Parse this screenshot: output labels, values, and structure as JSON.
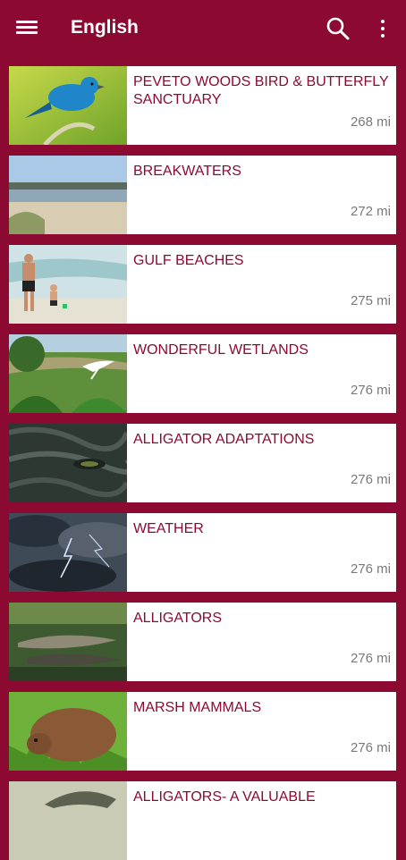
{
  "appbar": {
    "title": "English"
  },
  "items": [
    {
      "name": "PEVETO WOODS BIRD & BUTTERFLY SANCTUARY",
      "distance": "268 mi",
      "image": "indigo-bunting-bird"
    },
    {
      "name": "BREAKWATERS",
      "distance": "272 mi",
      "image": "beach-shoreline"
    },
    {
      "name": "GULF BEACHES",
      "distance": "275 mi",
      "image": "family-at-beach"
    },
    {
      "name": "WONDERFUL WETLANDS",
      "distance": "276 mi",
      "image": "egret-in-wetland"
    },
    {
      "name": "ALLIGATOR ADAPTATIONS",
      "distance": "276 mi",
      "image": "alligator-eye"
    },
    {
      "name": "WEATHER",
      "distance": "276 mi",
      "image": "storm-lightning"
    },
    {
      "name": "ALLIGATORS",
      "distance": "276 mi",
      "image": "alligators-in-water"
    },
    {
      "name": "MARSH MAMMALS",
      "distance": "276 mi",
      "image": "nutria"
    },
    {
      "name": "ALLIGATORS- A VALUABLE",
      "distance": "",
      "image": "alligator-head"
    }
  ]
}
